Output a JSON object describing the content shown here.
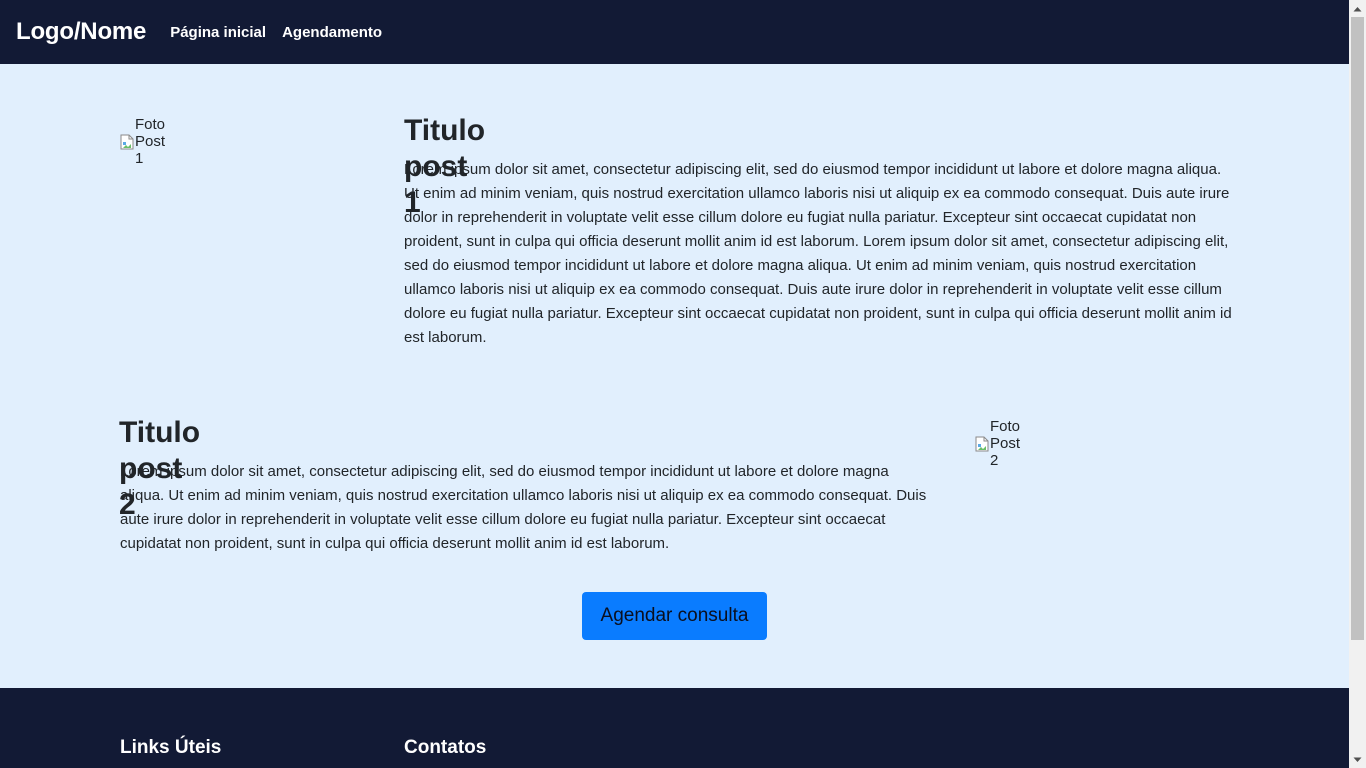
{
  "navbar": {
    "brand": "Logo/Nome",
    "links": [
      "Página inicial",
      "Agendamento"
    ]
  },
  "posts": [
    {
      "image_alt": "Foto Post 1",
      "title": "Titulo post 1",
      "text": "Lorem ipsum dolor sit amet, consectetur adipiscing elit, sed do eiusmod tempor incididunt ut labore et dolore magna aliqua. Ut enim ad minim veniam, quis nostrud exercitation ullamco laboris nisi ut aliquip ex ea commodo consequat. Duis aute irure dolor in reprehenderit in voluptate velit esse cillum dolore eu fugiat nulla pariatur. Excepteur sint occaecat cupidatat non proident, sunt in culpa qui officia deserunt mollit anim id est laborum. Lorem ipsum dolor sit amet, consectetur adipiscing elit, sed do eiusmod tempor incididunt ut labore et dolore magna aliqua. Ut enim ad minim veniam, quis nostrud exercitation ullamco laboris nisi ut aliquip ex ea commodo consequat. Duis aute irure dolor in reprehenderit in voluptate velit esse cillum dolore eu fugiat nulla pariatur. Excepteur sint occaecat cupidatat non proident, sunt in culpa qui officia deserunt mollit anim id est laborum."
    },
    {
      "image_alt": "Foto Post 2",
      "title": "Titulo post 2",
      "text": "Lorem ipsum dolor sit amet, consectetur adipiscing elit, sed do eiusmod tempor incididunt ut labore et dolore magna aliqua. Ut enim ad minim veniam, quis nostrud exercitation ullamco laboris nisi ut aliquip ex ea commodo consequat. Duis aute irure dolor in reprehenderit in voluptate velit esse cillum dolore eu fugiat nulla pariatur. Excepteur sint occaecat cupidatat non proident, sunt in culpa qui officia deserunt mollit anim id est laborum."
    }
  ],
  "cta": {
    "label": "Agendar consulta"
  },
  "footer": {
    "links_heading": "Links Úteis",
    "contacts_heading": "Contatos"
  },
  "colors": {
    "navbar_bg": "#121a35",
    "page_bg": "#e1effd",
    "cta_bg": "#0a7cff"
  }
}
